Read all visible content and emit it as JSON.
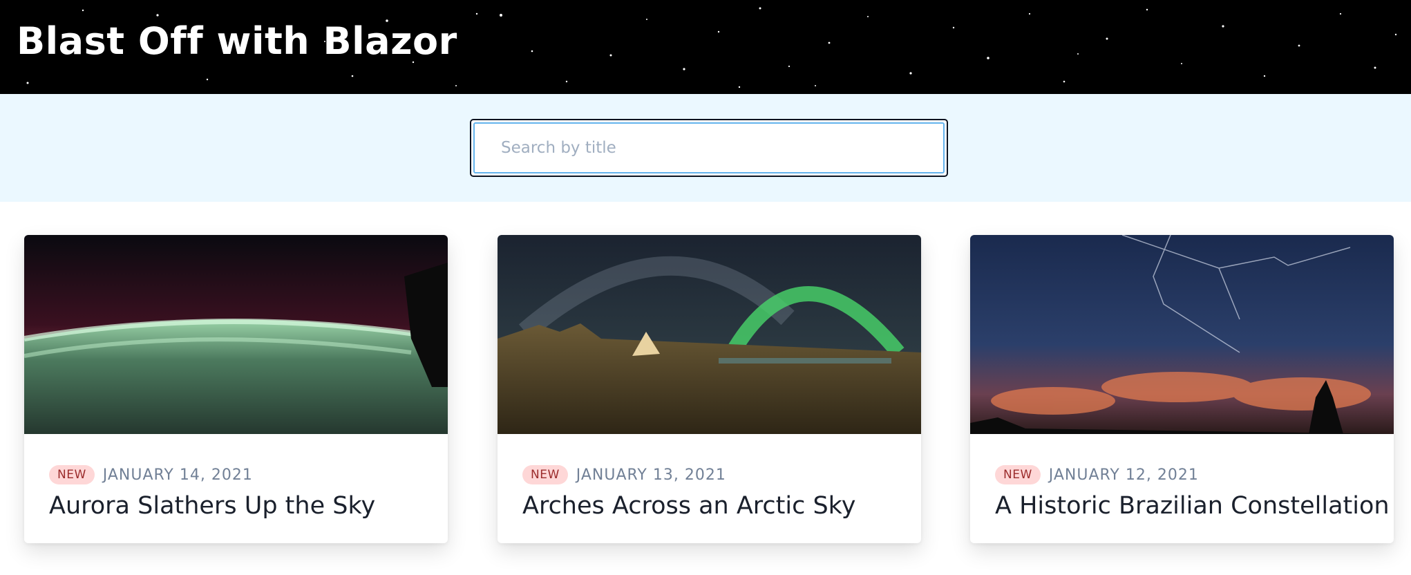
{
  "header": {
    "title": "Blast Off with Blazor"
  },
  "search": {
    "placeholder": "Search by title",
    "value": ""
  },
  "cards": [
    {
      "badge": "NEW",
      "date": "JANUARY 14, 2021",
      "title": "Aurora Slathers Up the Sky",
      "image_icon": "aurora-over-earth-image"
    },
    {
      "badge": "NEW",
      "date": "JANUARY 13, 2021",
      "title": "Arches Across an Arctic Sky",
      "image_icon": "arctic-arch-image"
    },
    {
      "badge": "NEW",
      "date": "JANUARY 12, 2021",
      "title": "A Historic Brazilian Constellation",
      "image_icon": "constellation-image"
    }
  ],
  "colors": {
    "header_bg": "#000000",
    "search_band_bg": "#ebf8ff",
    "search_focus": "#63b3ed",
    "badge_bg": "#fed7d7",
    "badge_text": "#9b2c2c",
    "date_text": "#718096"
  }
}
